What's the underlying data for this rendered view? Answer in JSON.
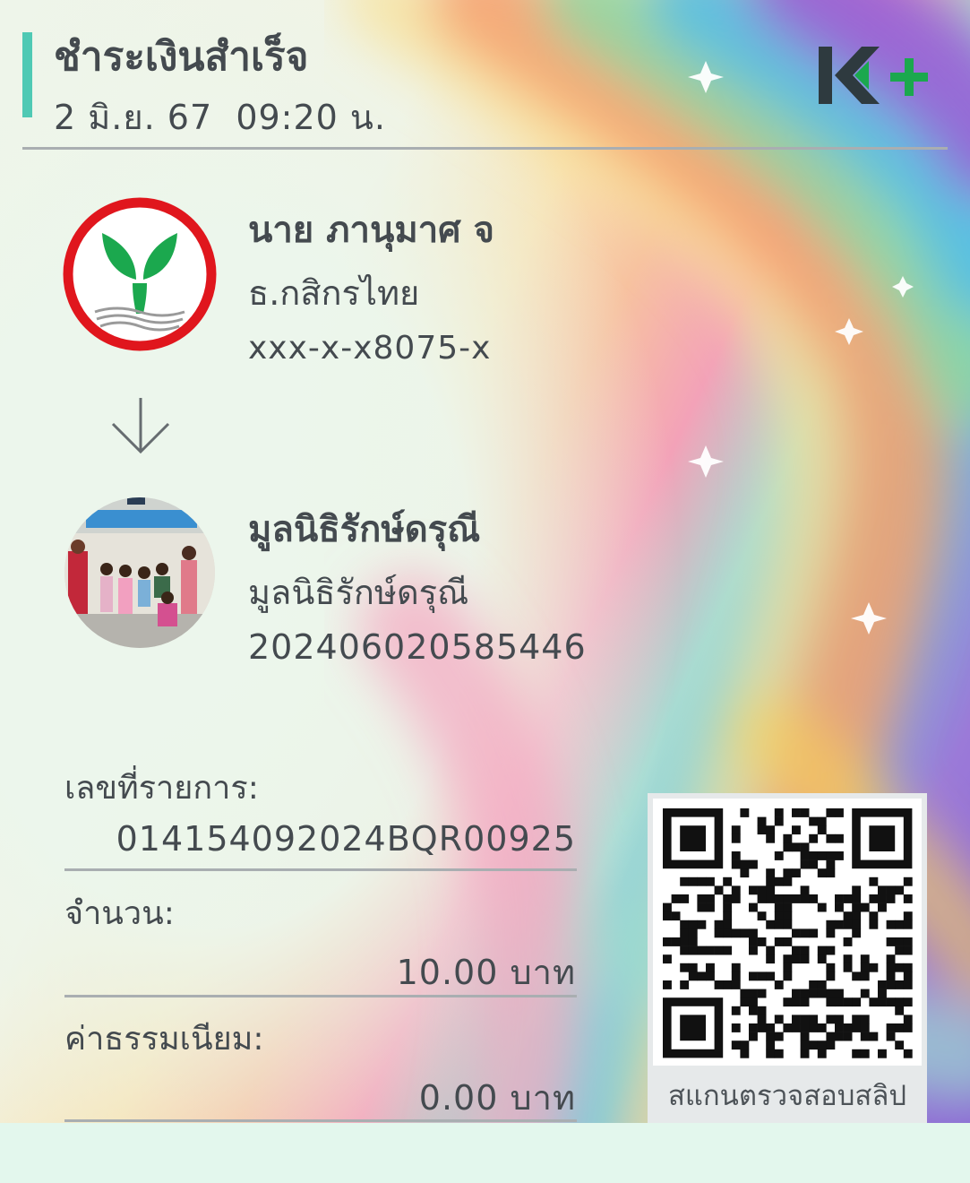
{
  "header": {
    "title": "ชำระเงินสำเร็จ",
    "datetime": "2 มิ.ย. 67  09:20 น.",
    "brand_logo": "K+"
  },
  "sender": {
    "name": "นาย ภานุมาศ จ",
    "bank": "ธ.กสิกรไทย",
    "account": "xxx-x-x8075-x",
    "logo_icon": "kasikorn-bank-logo"
  },
  "transfer_arrow_icon": "arrow-down-icon",
  "receiver": {
    "name": "มูลนิธิรักษ์ดรุณี",
    "display_name": "มูลนิธิรักษ์ดรุณี",
    "reference": "202406020585446",
    "photo_icon": "children-group-photo"
  },
  "details": {
    "transaction_label": "เลขที่รายการ:",
    "transaction_value": "014154092024BQR00925",
    "amount_label": "จำนวน:",
    "amount_value": "10.00 บาท",
    "fee_label": "ค่าธรรมเนียม:",
    "fee_value": "0.00 บาท"
  },
  "qr": {
    "caption": "สแกนตรวจสอบสลิป"
  },
  "colors": {
    "accent": "#4fc9b4",
    "text": "#444a4f",
    "kbank_green": "#1ba84e",
    "kbank_red": "#e0161d"
  }
}
